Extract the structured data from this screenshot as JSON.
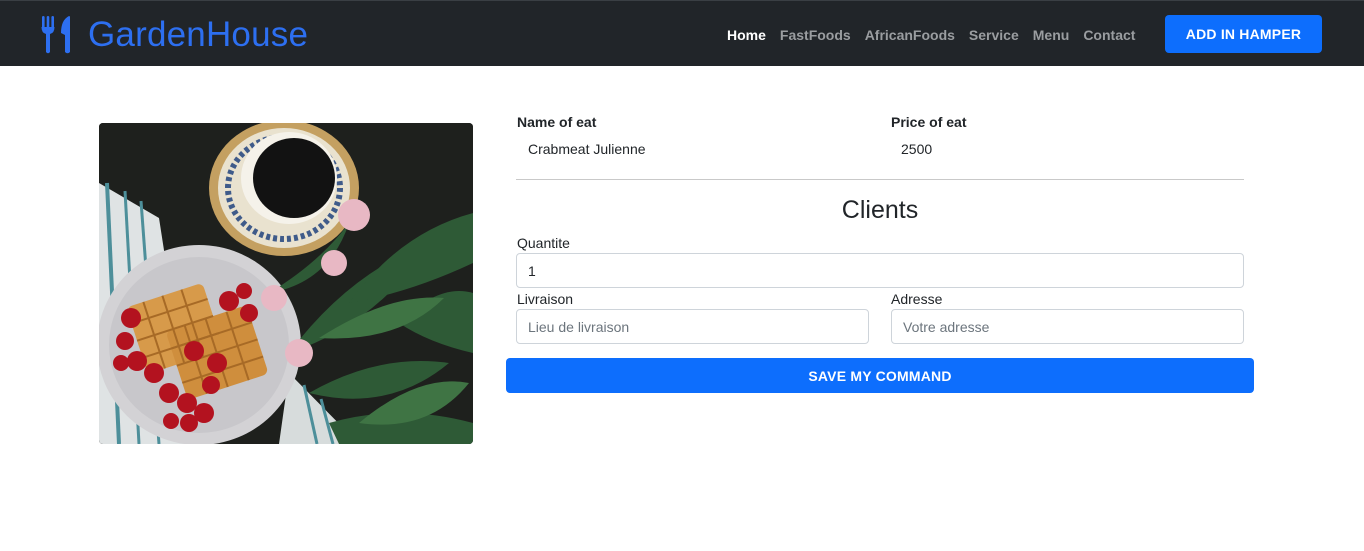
{
  "brand": {
    "name": "GardenHouse",
    "icon": "utensils-icon",
    "color": "#2d6ff0"
  },
  "nav": {
    "items": [
      {
        "label": "Home",
        "active": true
      },
      {
        "label": "FastFoods",
        "active": false
      },
      {
        "label": "AfricanFoods",
        "active": false
      },
      {
        "label": "Service",
        "active": false
      },
      {
        "label": "Menu",
        "active": false
      },
      {
        "label": "Contact",
        "active": false
      }
    ],
    "hamper_button": "ADD IN HAMPER"
  },
  "product": {
    "name_label": "Name of eat",
    "name_value": "Crabmeat Julienne",
    "price_label": "Price of eat",
    "price_value": "2500"
  },
  "form": {
    "title": "Clients",
    "quantity_label": "Quantite",
    "quantity_value": "1",
    "delivery_label": "Livraison",
    "delivery_placeholder": "Lieu de livraison",
    "address_label": "Adresse",
    "address_placeholder": "Votre adresse",
    "submit_label": "SAVE MY COMMAND"
  },
  "colors": {
    "navbar": "#212529",
    "primary": "#0d6efd",
    "nav_inactive": "#9a9da0"
  }
}
